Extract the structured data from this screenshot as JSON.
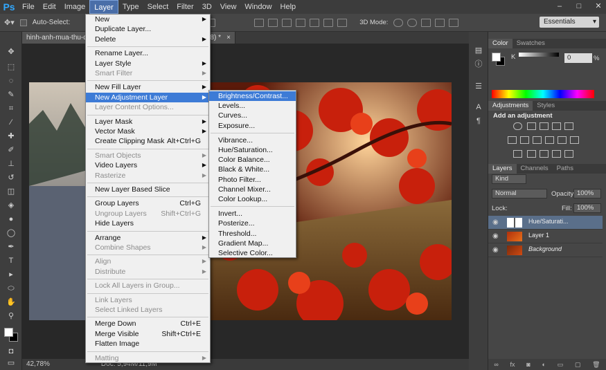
{
  "app": {
    "logo": "Ps"
  },
  "menubar": {
    "items": [
      "File",
      "Edit",
      "Image",
      "Layer",
      "Type",
      "Select",
      "Filter",
      "3D",
      "View",
      "Window",
      "Help"
    ],
    "active": "Layer"
  },
  "window_controls": {
    "minimize": "–",
    "maximize": "□",
    "close": "✕"
  },
  "options_bar": {
    "auto_select": "Auto-Select:",
    "mode_3d": "3D Mode:",
    "workspace": "Essentials"
  },
  "document": {
    "tab_title": "hinh-anh-mua-thu-de",
    "tab_suffix": "/8) *",
    "close": "×"
  },
  "status": {
    "zoom": "42,78%",
    "doc": "Doc: 5,94M/11,9M"
  },
  "layer_menu": [
    {
      "label": "New",
      "arrow": true
    },
    {
      "label": "Duplicate Layer..."
    },
    {
      "label": "Delete",
      "arrow": true
    },
    {
      "sep": true
    },
    {
      "label": "Rename Layer..."
    },
    {
      "label": "Layer Style",
      "arrow": true
    },
    {
      "label": "Smart Filter",
      "arrow": true,
      "disabled": true
    },
    {
      "sep": true
    },
    {
      "label": "New Fill Layer",
      "arrow": true
    },
    {
      "label": "New Adjustment Layer",
      "arrow": true,
      "highlight": true
    },
    {
      "label": "Layer Content Options...",
      "disabled": true
    },
    {
      "sep": true
    },
    {
      "label": "Layer Mask",
      "arrow": true
    },
    {
      "label": "Vector Mask",
      "arrow": true
    },
    {
      "label": "Create Clipping Mask",
      "shortcut": "Alt+Ctrl+G"
    },
    {
      "sep": true
    },
    {
      "label": "Smart Objects",
      "arrow": true,
      "disabled": true
    },
    {
      "label": "Video Layers",
      "arrow": true
    },
    {
      "label": "Rasterize",
      "arrow": true,
      "disabled": true
    },
    {
      "sep": true
    },
    {
      "label": "New Layer Based Slice"
    },
    {
      "sep": true
    },
    {
      "label": "Group Layers",
      "shortcut": "Ctrl+G"
    },
    {
      "label": "Ungroup Layers",
      "shortcut": "Shift+Ctrl+G",
      "disabled": true
    },
    {
      "label": "Hide Layers"
    },
    {
      "sep": true
    },
    {
      "label": "Arrange",
      "arrow": true
    },
    {
      "label": "Combine Shapes",
      "arrow": true,
      "disabled": true
    },
    {
      "sep": true
    },
    {
      "label": "Align",
      "arrow": true,
      "disabled": true
    },
    {
      "label": "Distribute",
      "arrow": true,
      "disabled": true
    },
    {
      "sep": true
    },
    {
      "label": "Lock All Layers in Group...",
      "disabled": true
    },
    {
      "sep": true
    },
    {
      "label": "Link Layers",
      "disabled": true
    },
    {
      "label": "Select Linked Layers",
      "disabled": true
    },
    {
      "sep": true
    },
    {
      "label": "Merge Down",
      "shortcut": "Ctrl+E"
    },
    {
      "label": "Merge Visible",
      "shortcut": "Shift+Ctrl+E"
    },
    {
      "label": "Flatten Image"
    },
    {
      "sep": true
    },
    {
      "label": "Matting",
      "arrow": true,
      "disabled": true
    }
  ],
  "adjustment_submenu": [
    {
      "label": "Brightness/Contrast...",
      "highlight": true
    },
    {
      "label": "Levels..."
    },
    {
      "label": "Curves..."
    },
    {
      "label": "Exposure..."
    },
    {
      "sep": true
    },
    {
      "label": "Vibrance..."
    },
    {
      "label": "Hue/Saturation..."
    },
    {
      "label": "Color Balance..."
    },
    {
      "label": "Black & White..."
    },
    {
      "label": "Photo Filter..."
    },
    {
      "label": "Channel Mixer..."
    },
    {
      "label": "Color Lookup..."
    },
    {
      "sep": true
    },
    {
      "label": "Invert..."
    },
    {
      "label": "Posterize..."
    },
    {
      "label": "Threshold..."
    },
    {
      "label": "Gradient Map..."
    },
    {
      "label": "Selective Color..."
    }
  ],
  "color_panel": {
    "tabs": [
      "Color",
      "Swatches"
    ],
    "k_label": "K",
    "k_value": "0",
    "k_unit": "%"
  },
  "adjustments_panel": {
    "tabs": [
      "Adjustments",
      "Styles"
    ],
    "title": "Add an adjustment"
  },
  "layers_panel": {
    "tabs": [
      "Layers",
      "Channels",
      "Paths"
    ],
    "kind": "Kind",
    "blend_mode": "Normal",
    "opacity_label": "Opacity:",
    "opacity_value": "100%",
    "lock_label": "Lock:",
    "fill_label": "Fill:",
    "fill_value": "100%",
    "layers": [
      {
        "name": "Hue/Saturati...",
        "selected": true
      },
      {
        "name": "Layer 1"
      },
      {
        "name": "Background",
        "italic": true
      }
    ]
  }
}
